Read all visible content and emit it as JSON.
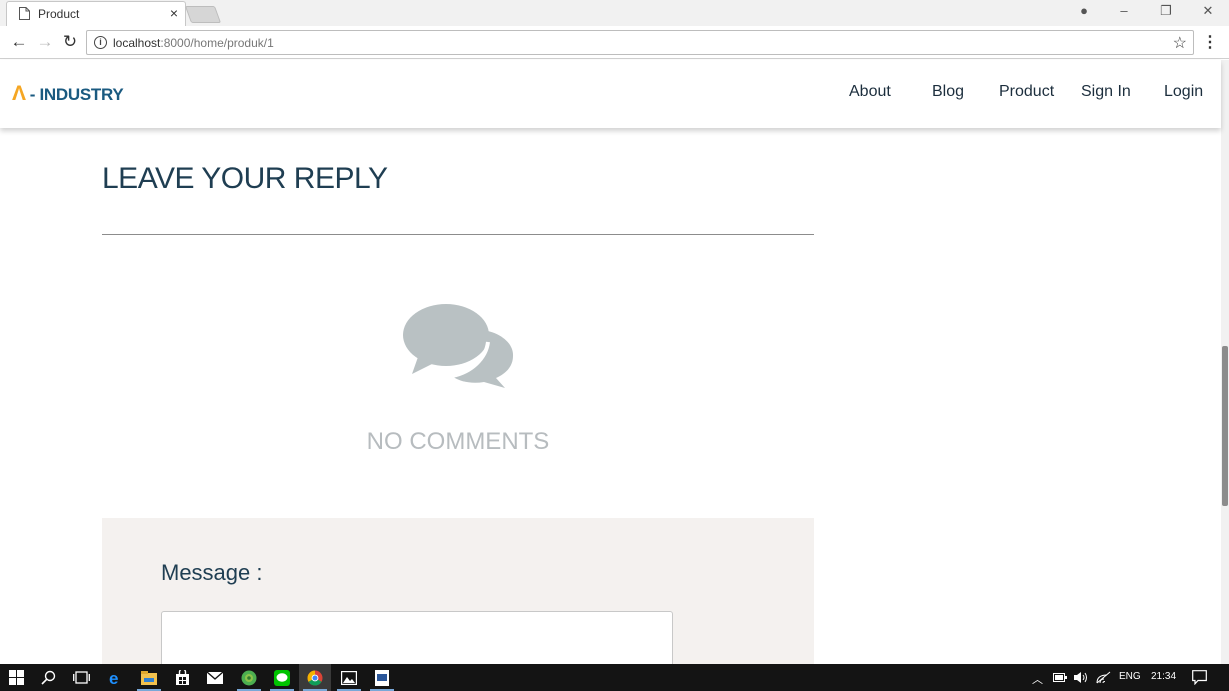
{
  "browser": {
    "tab_title": "Product",
    "tab_close": "×",
    "url_host": "localhost",
    "url_path": ":8000/home/produk/1",
    "back": "←",
    "forward": "→",
    "reload": "↻",
    "star": "☆",
    "menu": "⋮",
    "controls": {
      "profile": "●",
      "minimize": "–",
      "restore": "❐",
      "close": "✕"
    }
  },
  "site": {
    "logo_mark": "Λ",
    "logo_text": "- INDUSTRY",
    "nav": [
      "About",
      "Blog",
      "Product",
      "Sign In",
      "Login"
    ],
    "heading": "LEAVE YOUR REPLY",
    "no_comments": "NO COMMENTS",
    "message_label": "Message :",
    "message_value": ""
  },
  "taskbar": {
    "icons": [
      "windows-start-icon",
      "search-icon",
      "task-view-icon",
      "edge-icon",
      "file-explorer-icon",
      "store-icon",
      "mail-icon",
      "browser-globe-icon",
      "line-chat-icon",
      "chrome-icon",
      "photos-icon",
      "word-doc-icon"
    ],
    "tray_lang": "ENG",
    "tray_time": "21:34"
  },
  "colors": {
    "brand_orange": "#f5a623",
    "brand_blue": "#1a5a80",
    "heading": "#1f3e52",
    "muted_gray": "#b7bcbf",
    "panel": "#f4f1ef"
  }
}
